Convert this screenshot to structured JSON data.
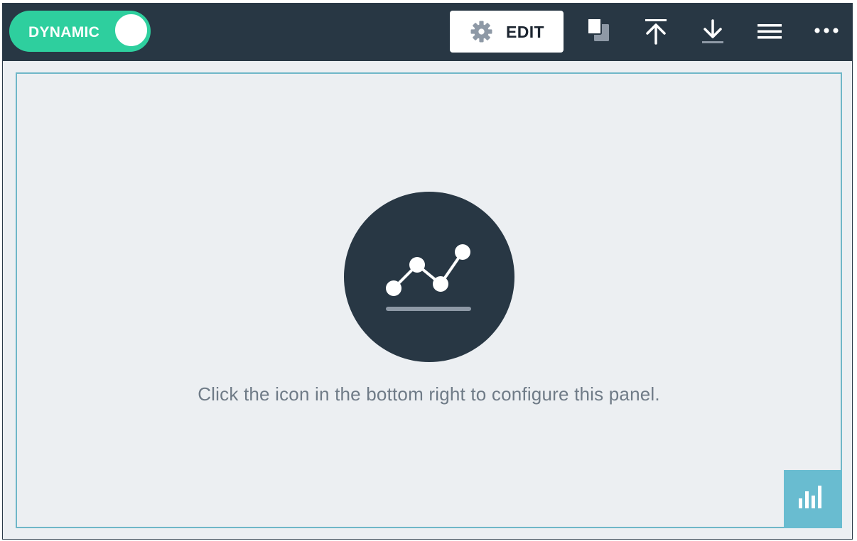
{
  "toolbar": {
    "toggle_label": "DYNAMIC",
    "toggle_on": true,
    "edit_label": "EDIT",
    "icons": [
      "gear-icon",
      "duplicate-icon",
      "upload-icon",
      "download-icon",
      "menu-icon",
      "more-icon"
    ]
  },
  "panel": {
    "message": "Click the icon in the bottom right to configure this panel.",
    "placeholder_icon": "line-chart-icon",
    "config_icon": "bar-chart-icon"
  },
  "colors": {
    "toolbar_bg": "#283744",
    "toggle_on": "#2ecf9e",
    "panel_bg": "#eceff2",
    "panel_border": "#6fb7c8",
    "config_button": "#69bcd0",
    "message_text": "#6f7b87"
  }
}
